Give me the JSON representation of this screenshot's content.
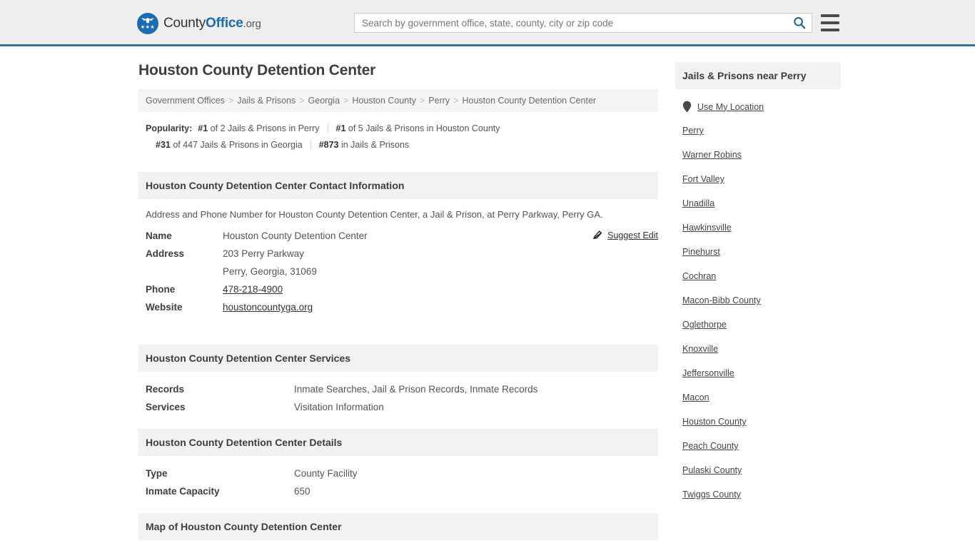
{
  "header": {
    "brand": {
      "part1": "County",
      "part2": "Office",
      "part3": ".org",
      "logo_icon": "eagle-stars-icon",
      "stars": "★★★"
    },
    "search": {
      "placeholder": "Search by government office, state, county, city or zip code",
      "value": "",
      "search_icon": "search-icon"
    },
    "menu_icon": "hamburger-menu-icon"
  },
  "page": {
    "title": "Houston County Detention Center"
  },
  "breadcrumb": {
    "separator": ">",
    "items": [
      {
        "label": "Government Offices"
      },
      {
        "label": "Jails & Prisons"
      },
      {
        "label": "Georgia"
      },
      {
        "label": "Houston County"
      },
      {
        "label": "Perry"
      },
      {
        "label": "Houston County Detention Center"
      }
    ]
  },
  "popularity": {
    "label": "Popularity:",
    "items": [
      {
        "rank": "#1",
        "rest": " of 2 Jails & Prisons in Perry"
      },
      {
        "rank": "#1",
        "rest": " of 5 Jails & Prisons in Houston County"
      },
      {
        "rank": "#31",
        "rest": " of 447 Jails & Prisons in Georgia"
      },
      {
        "rank": "#873",
        "rest": " in Jails & Prisons"
      }
    ]
  },
  "contact": {
    "heading": "Houston County Detention Center Contact Information",
    "description": "Address and Phone Number for Houston County Detention Center, a Jail & Prison, at Perry Parkway, Perry GA.",
    "suggest_edit": {
      "label": "Suggest Edit",
      "icon": "edit-pencil-icon"
    },
    "rows": [
      {
        "key": "Name",
        "value": "Houston County Detention Center",
        "link": false
      },
      {
        "key": "Address",
        "value": "203 Perry Parkway",
        "link": false
      },
      {
        "key": "",
        "value": "Perry, Georgia, 31069",
        "link": false
      },
      {
        "key": "Phone",
        "value": "478-218-4900",
        "link": true
      },
      {
        "key": "Website",
        "value": "houstoncountyga.org",
        "link": true
      }
    ]
  },
  "services": {
    "heading": "Houston County Detention Center Services",
    "rows": [
      {
        "key": "Records",
        "value": "Inmate Searches, Jail & Prison Records, Inmate Records"
      },
      {
        "key": "Services",
        "value": "Visitation Information"
      }
    ]
  },
  "details": {
    "heading": "Houston County Detention Center Details",
    "rows": [
      {
        "key": "Type",
        "value": "County Facility"
      },
      {
        "key": "Inmate Capacity",
        "value": "650"
      }
    ]
  },
  "map_section": {
    "heading": "Map of Houston County Detention Center"
  },
  "sidebar": {
    "heading": "Jails & Prisons near Perry",
    "use_my_location": {
      "label": "Use My Location",
      "icon": "map-pin-icon"
    },
    "links": [
      {
        "label": "Perry"
      },
      {
        "label": "Warner Robins"
      },
      {
        "label": "Fort Valley"
      },
      {
        "label": "Unadilla"
      },
      {
        "label": "Hawkinsville"
      },
      {
        "label": "Pinehurst"
      },
      {
        "label": "Cochran"
      },
      {
        "label": "Macon-Bibb County"
      },
      {
        "label": "Oglethorpe"
      },
      {
        "label": "Knoxville"
      },
      {
        "label": "Jeffersonville"
      },
      {
        "label": "Macon"
      },
      {
        "label": "Houston County"
      },
      {
        "label": "Peach County"
      },
      {
        "label": "Pulaski County"
      },
      {
        "label": "Twiggs County"
      }
    ]
  },
  "colors": {
    "brand_blue": "#1a6cb5",
    "header_bg": "#eeeeee",
    "header_border": "#35739f",
    "section_bg": "#f2f2f2",
    "breadcrumb_bg": "#f5f5f5"
  }
}
